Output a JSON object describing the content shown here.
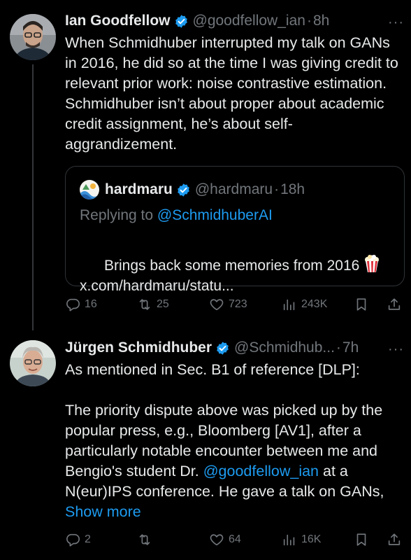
{
  "tweets": [
    {
      "author": {
        "name": "Ian Goodfellow",
        "handle": "@goodfellow_ian",
        "dot": "·",
        "time": "8h"
      },
      "more_label": "···",
      "text": "When Schmidhuber interrupted my talk on GANs in 2016, he did so at the time I was giving credit to relevant prior work: noise contrastive estimation. Schmidhuber isn’t about proper about academic credit assignment, he’s about self-aggrandizement.",
      "quoted": {
        "name": "hardmaru",
        "handle": "@hardmaru",
        "dot": "·",
        "time": "18h",
        "replying_prefix": "Replying to ",
        "replying_handle": "@SchmidhuberAI",
        "text_line1": "Brings back some memories from 2016 ",
        "emoji": "popcorn-icon",
        "link": "x.com/hardmaru/statu..."
      },
      "actions": {
        "replies": "16",
        "reposts": "25",
        "likes": "723",
        "views": "243K"
      }
    },
    {
      "author": {
        "name": "Jürgen Schmidhuber",
        "handle": "@Schmidhub...",
        "dot": "·",
        "time": "7h"
      },
      "more_label": "···",
      "text_part1": "As mentioned in Sec. B1 of reference [DLP]:\n\nThe priority dispute above was picked up by the popular press, e.g., Bloomberg [AV1], after a particularly notable encounter between me and Bengio's student Dr. ",
      "mention": "@goodfellow_ian",
      "text_part2": " at a N(eur)IPS conference. He gave a talk on GANs, ",
      "show_more": "Show more",
      "actions": {
        "replies": "2",
        "reposts": "",
        "likes": "64",
        "views": "16K"
      }
    }
  ],
  "colors": {
    "background": "#000000",
    "text": "#e7e9ea",
    "secondary": "#71767b",
    "accent": "#1d9bf0",
    "border": "#2f3336"
  }
}
